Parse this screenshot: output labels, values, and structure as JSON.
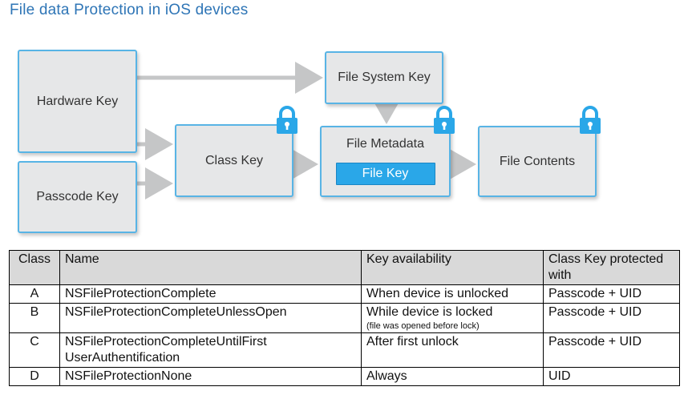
{
  "title": "File data Protection in iOS devices",
  "diagram": {
    "hardware_key": "Hardware Key",
    "passcode_key": "Passcode Key",
    "file_system_key": "File System Key",
    "class_key": "Class Key",
    "file_metadata": "File Metadata",
    "file_key": "File Key",
    "file_contents": "File Contents",
    "colors": {
      "box_fill": "#e6e7e8",
      "box_border": "#58b4e5",
      "arrow": "#c5c6c7",
      "lock": "#2aa7e8",
      "file_key_fill": "#2aa7e8"
    },
    "lock_icon": "padlock-icon"
  },
  "table": {
    "headers": {
      "class": "Class",
      "name": "Name",
      "availability": "Key availability",
      "protected_with": "Class Key protected with"
    },
    "rows": [
      {
        "class": "A",
        "name": "NSFileProtectionComplete",
        "availability": "When device is unlocked",
        "note": "",
        "protected_with": "Passcode + UID"
      },
      {
        "class": "B",
        "name": "NSFileProtectionCompleteUnlessOpen",
        "availability": "While device is locked",
        "note": "(file was opened before lock)",
        "protected_with": "Passcode + UID"
      },
      {
        "class": "C",
        "name": "NSFileProtectionCompleteUntilFirst UserAuthentification",
        "availability": "After first unlock",
        "note": "",
        "protected_with": "Passcode + UID"
      },
      {
        "class": "D",
        "name": "NSFileProtectionNone",
        "availability": "Always",
        "note": "",
        "protected_with": "UID"
      }
    ]
  }
}
